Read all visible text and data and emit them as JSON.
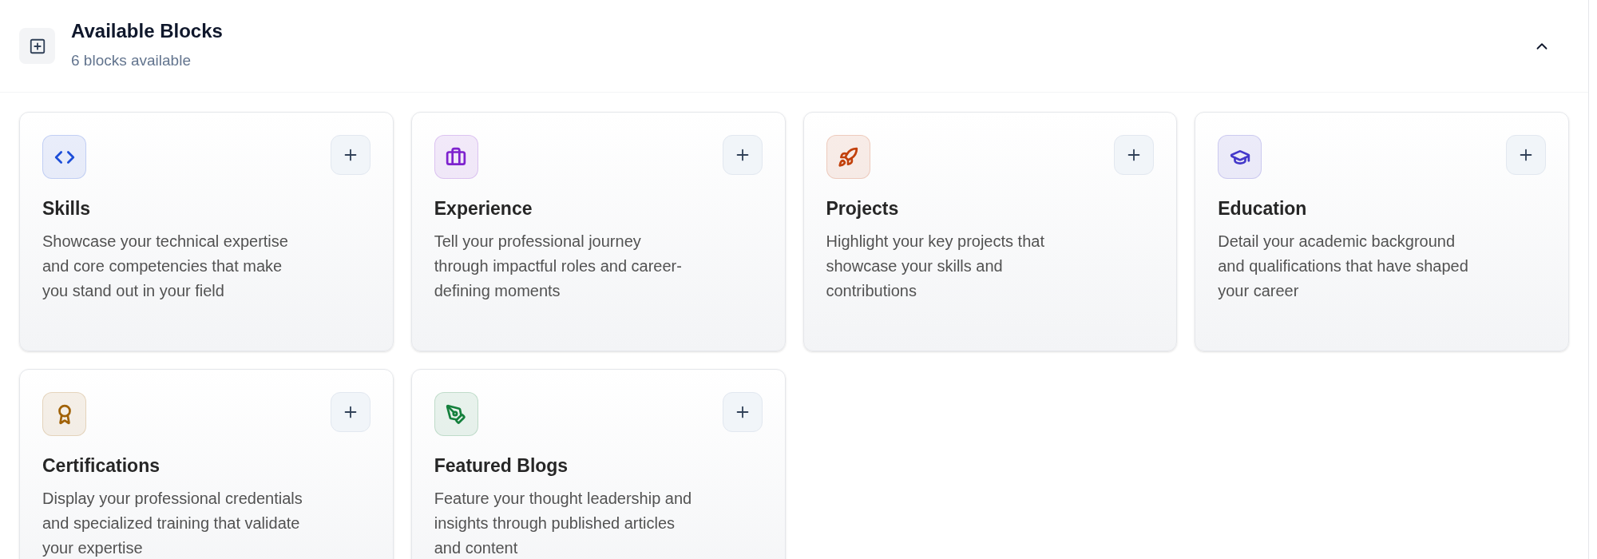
{
  "header": {
    "title": "Available Blocks",
    "subtitle": "6 blocks available",
    "expanded": true
  },
  "blocks": [
    {
      "title": "Skills",
      "description": "Showcase your technical expertise and core competencies that make you stand out in your field",
      "color": "#1d4ed8"
    },
    {
      "title": "Experience",
      "description": "Tell your professional journey through impactful roles and career-defining moments",
      "color": "#7e22ce"
    },
    {
      "title": "Projects",
      "description": "Highlight your key projects that showcase your skills and contributions",
      "color": "#c2410c"
    },
    {
      "title": "Education",
      "description": "Detail your academic background and qualifications that have shaped your career",
      "color": "#4338ca"
    },
    {
      "title": "Certifications",
      "description": "Display your professional credentials and specialized training that validate your expertise",
      "color": "#a16207"
    },
    {
      "title": "Featured Blogs",
      "description": "Feature your thought leadership and insights through published articles and content",
      "color": "#15803d"
    }
  ]
}
